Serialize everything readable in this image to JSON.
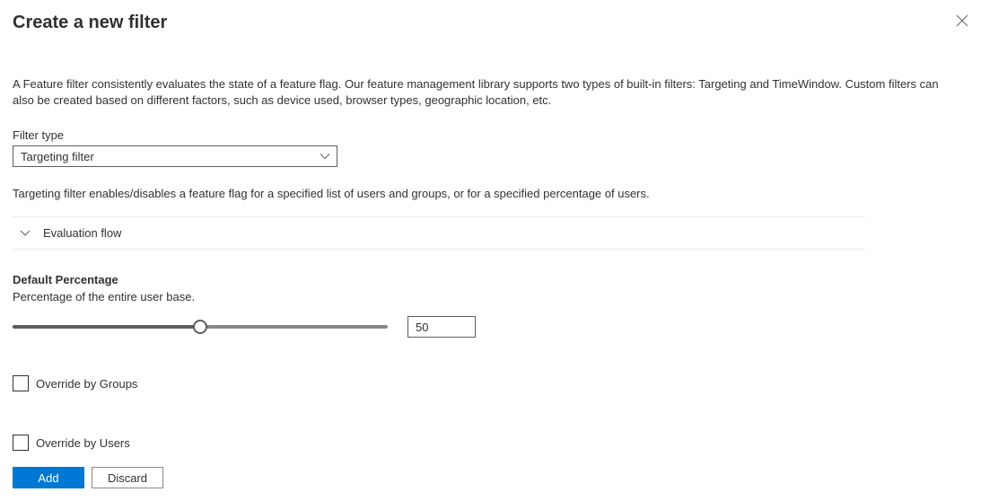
{
  "header": {
    "title": "Create a new filter"
  },
  "description": "A Feature filter consistently evaluates the state of a feature flag. Our feature management library supports two types of built-in filters: Targeting and TimeWindow. Custom filters can also be created based on different factors, such as device used, browser types, geographic location, etc.",
  "filterType": {
    "label": "Filter type",
    "selected": "Targeting filter"
  },
  "targetingDescription": "Targeting filter enables/disables a feature flag for a specified list of users and groups, or for a specified percentage of users.",
  "evaluationFlow": {
    "label": "Evaluation flow"
  },
  "defaultPercentage": {
    "title": "Default Percentage",
    "subtitle": "Percentage of the entire user base.",
    "value": "50"
  },
  "overrideGroups": {
    "label": "Override by Groups"
  },
  "overrideUsers": {
    "label": "Override by Users"
  },
  "footer": {
    "add": "Add",
    "discard": "Discard"
  }
}
